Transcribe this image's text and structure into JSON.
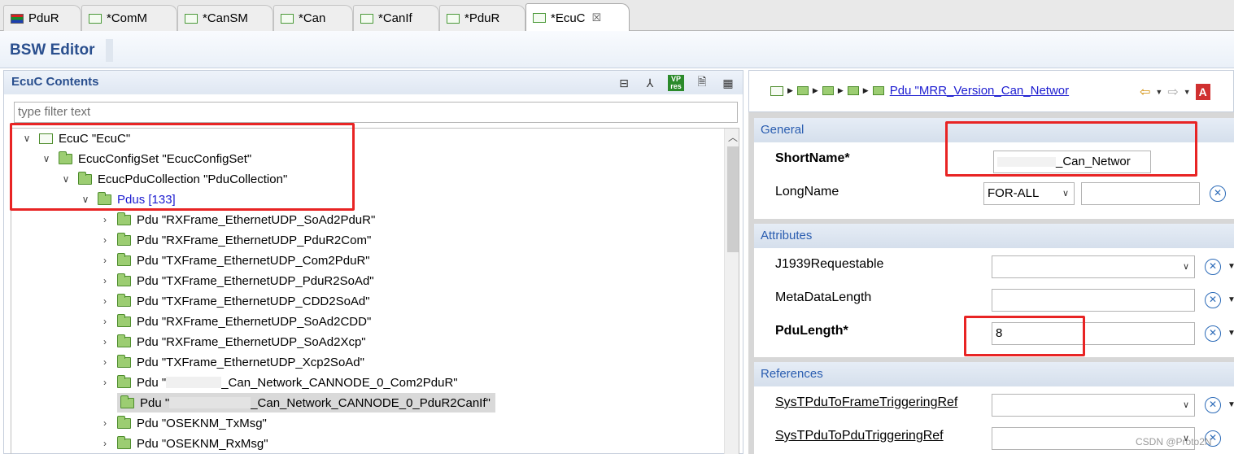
{
  "tabs": [
    {
      "label": "PduR",
      "icon": "module-app-icon"
    },
    {
      "label": "*ComM",
      "icon": "module-icon"
    },
    {
      "label": "*CanSM",
      "icon": "module-icon"
    },
    {
      "label": "*Can",
      "icon": "module-icon"
    },
    {
      "label": "*CanIf",
      "icon": "module-icon"
    },
    {
      "label": "*PduR",
      "icon": "module-icon"
    },
    {
      "label": "*EcuC",
      "icon": "module-icon",
      "close": "☒"
    }
  ],
  "header": {
    "title": "BSW Editor"
  },
  "left": {
    "title": "EcuC Contents",
    "filter_placeholder": "type filter text",
    "tree": [
      {
        "text": "EcuC \"EcuC\"",
        "twisty": "open"
      },
      {
        "text": "EcucConfigSet \"EcucConfigSet\"",
        "twisty": "open"
      },
      {
        "text": "EcucPduCollection \"PduCollection\"",
        "twisty": "open"
      },
      {
        "text": "Pdus [133]",
        "twisty": "open"
      },
      {
        "text": "Pdu \"RXFrame_EthernetUDP_SoAd2PduR\"",
        "twisty": "closed"
      },
      {
        "text": "Pdu \"RXFrame_EthernetUDP_PduR2Com\"",
        "twisty": "closed"
      },
      {
        "text": "Pdu \"TXFrame_EthernetUDP_Com2PduR\"",
        "twisty": "closed"
      },
      {
        "text": "Pdu \"TXFrame_EthernetUDP_PduR2SoAd\"",
        "twisty": "closed"
      },
      {
        "text": "Pdu \"TXFrame_EthernetUDP_CDD2SoAd\"",
        "twisty": "closed"
      },
      {
        "text": "Pdu \"RXFrame_EthernetUDP_SoAd2CDD\"",
        "twisty": "closed"
      },
      {
        "text": "Pdu \"RXFrame_EthernetUDP_SoAd2Xcp\"",
        "twisty": "closed"
      },
      {
        "text": "Pdu \"TXFrame_EthernetUDP_Xcp2SoAd\"",
        "twisty": "closed"
      },
      {
        "text": "Pdu \"",
        "suffix": "_Can_Network_CANNODE_0_Com2PduR\"",
        "twisty": "closed"
      },
      {
        "text": "Pdu \"",
        "suffix": "_Can_Network_CANNODE_0_PduR2CanIf\"",
        "twisty": "closed"
      },
      {
        "text": "Pdu \"OSEKNM_TxMsg\"",
        "twisty": "closed"
      },
      {
        "text": "Pdu \"OSEKNM_RxMsg\"",
        "twisty": "closed"
      }
    ]
  },
  "right": {
    "breadcrumb_link": "Pdu \"MRR_Version_Can_Networ",
    "general": {
      "title": "General",
      "shortname_label": "ShortName*",
      "shortname_value": "_Can_Networ",
      "longname_label": "LongName",
      "longname_lang": "FOR-ALL"
    },
    "attributes": {
      "title": "Attributes",
      "j1939_label": "J1939Requestable",
      "metadata_label": "MetaDataLength",
      "pdulength_label": "PduLength*",
      "pdulength_value": "8"
    },
    "references": {
      "title": "References",
      "ref1_label": "SysTPduToFrameTriggeringRef",
      "ref2_label": "SysTPduToPduTriggeringRef"
    }
  },
  "watermark": "CSDN @Proto2N",
  "colors": {
    "accent": "#2a4f8e",
    "highlight": "#e82424",
    "folder": "#9ccd72"
  }
}
